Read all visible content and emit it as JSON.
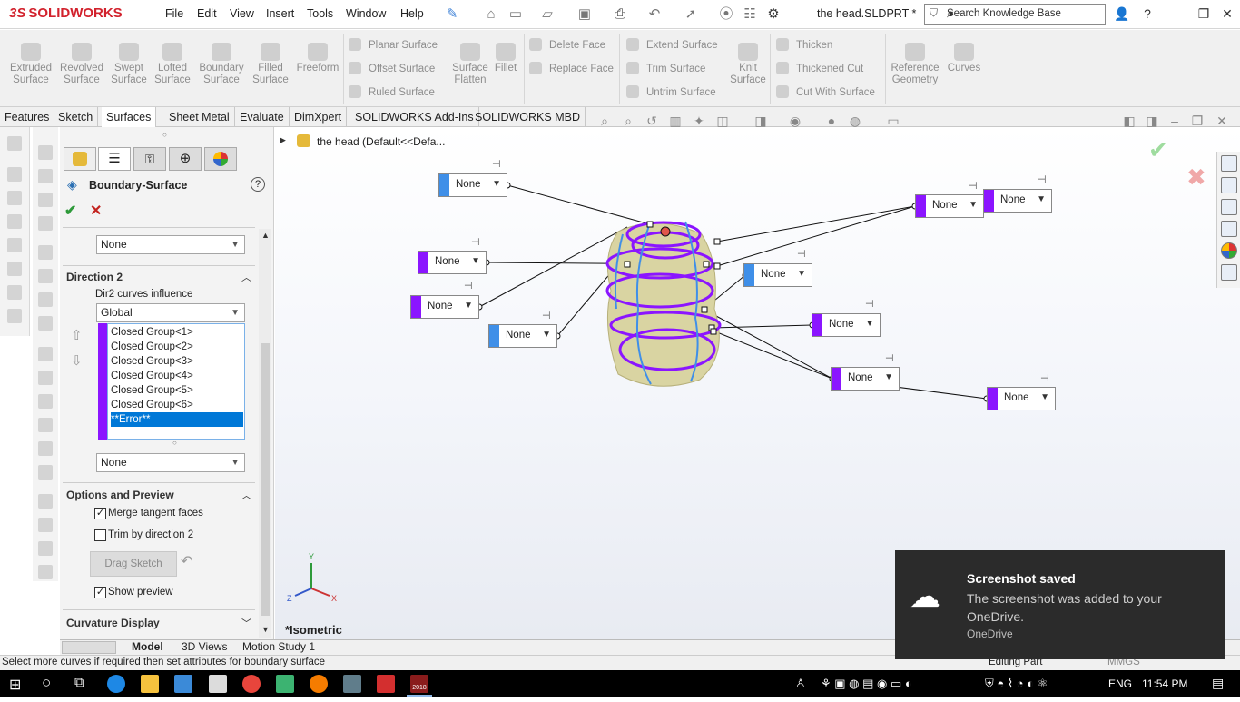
{
  "app": {
    "brand_prefix": "3S",
    "brand": "SOLIDWORKS",
    "doc_title": "the head.SLDPRT *"
  },
  "menu": [
    "File",
    "Edit",
    "View",
    "Insert",
    "Tools",
    "Window",
    "Help"
  ],
  "search": {
    "placeholder": "Search Knowledge Base"
  },
  "ribbon": {
    "big_tools": [
      "Extruded Surface",
      "Revolved Surface",
      "Swept Surface",
      "Lofted Surface",
      "Boundary Surface",
      "Filled Surface",
      "Freeform"
    ],
    "group1": [
      "Planar Surface",
      "Offset Surface",
      "Ruled Surface"
    ],
    "flatten": "Surface Flatten",
    "fillet": "Fillet",
    "group2": [
      "Delete Face",
      "Replace Face"
    ],
    "group3": [
      "Extend Surface",
      "Trim Surface",
      "Untrim Surface"
    ],
    "knit": "Knit Surface",
    "group4": [
      "Thicken",
      "Thickened Cut",
      "Cut With Surface"
    ],
    "refgeom": "Reference Geometry",
    "curves": "Curves"
  },
  "tabs": [
    "Features",
    "Sketch",
    "Surfaces",
    "Sheet Metal",
    "Evaluate",
    "DimXpert",
    "SOLIDWORKS Add-Ins",
    "SOLIDWORKS MBD"
  ],
  "active_tab": "Surfaces",
  "pm": {
    "title": "Boundary-Surface",
    "top_combo": "None",
    "direction2": "Direction 2",
    "influence_label": "Dir2 curves influence",
    "influence_value": "Global",
    "curves": [
      "Closed Group<1>",
      "Closed Group<2>",
      "Closed Group<3>",
      "Closed Group<4>",
      "Closed Group<5>",
      "Closed Group<6>",
      "**Error**"
    ],
    "bottom_combo": "None",
    "options_title": "Options and Preview",
    "merge_label": "Merge tangent faces",
    "merge_checked": true,
    "trim_label": "Trim by direction 2",
    "trim_checked": false,
    "drag_sketch": "Drag Sketch",
    "preview_label": "Show preview",
    "preview_checked": true,
    "curvature": "Curvature Display"
  },
  "tree": {
    "root": "the head  (Default<<Defa..."
  },
  "callouts": [
    "None",
    "None",
    "None",
    "None",
    "None",
    "None",
    "None",
    "None",
    "None",
    "None",
    "None"
  ],
  "view_label": "*Isometric",
  "triad": {
    "x": "X",
    "y": "Y",
    "z": "Z"
  },
  "bottom_tabs": [
    "Model",
    "3D Views",
    "Motion Study 1"
  ],
  "status": {
    "message": "Select more curves if required then set attributes for boundary surface",
    "mode": "Editing Part",
    "units": "MMGS"
  },
  "toast": {
    "title": "Screenshot saved",
    "body": "The screenshot was added to your OneDrive.",
    "source": "OneDrive"
  },
  "taskbar": {
    "lang": "ENG",
    "time": "11:54 PM",
    "badge": "2018"
  },
  "colors": {
    "accent_purple": "#8b15ff",
    "accent_blue": "#3f8fe8",
    "brand_red": "#d2222d"
  }
}
